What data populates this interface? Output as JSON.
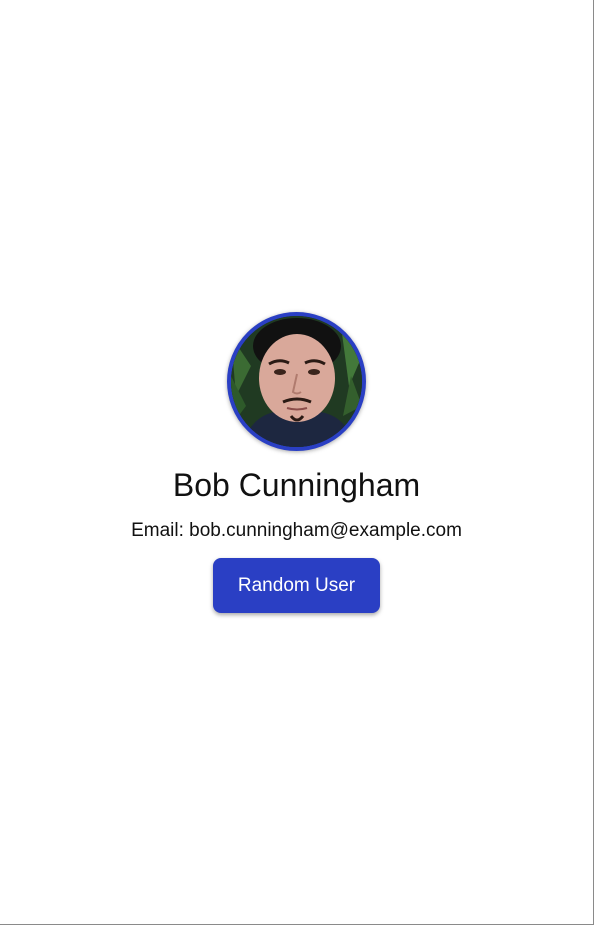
{
  "profile": {
    "name": "Bob Cunningham",
    "email_label": "Email:",
    "email": "bob.cunningham@example.com",
    "email_line": "Email: bob.cunningham@example.com"
  },
  "actions": {
    "random_user_label": "Random User"
  },
  "colors": {
    "accent": "#2a3fc4",
    "text": "#111111",
    "background": "#ffffff"
  }
}
